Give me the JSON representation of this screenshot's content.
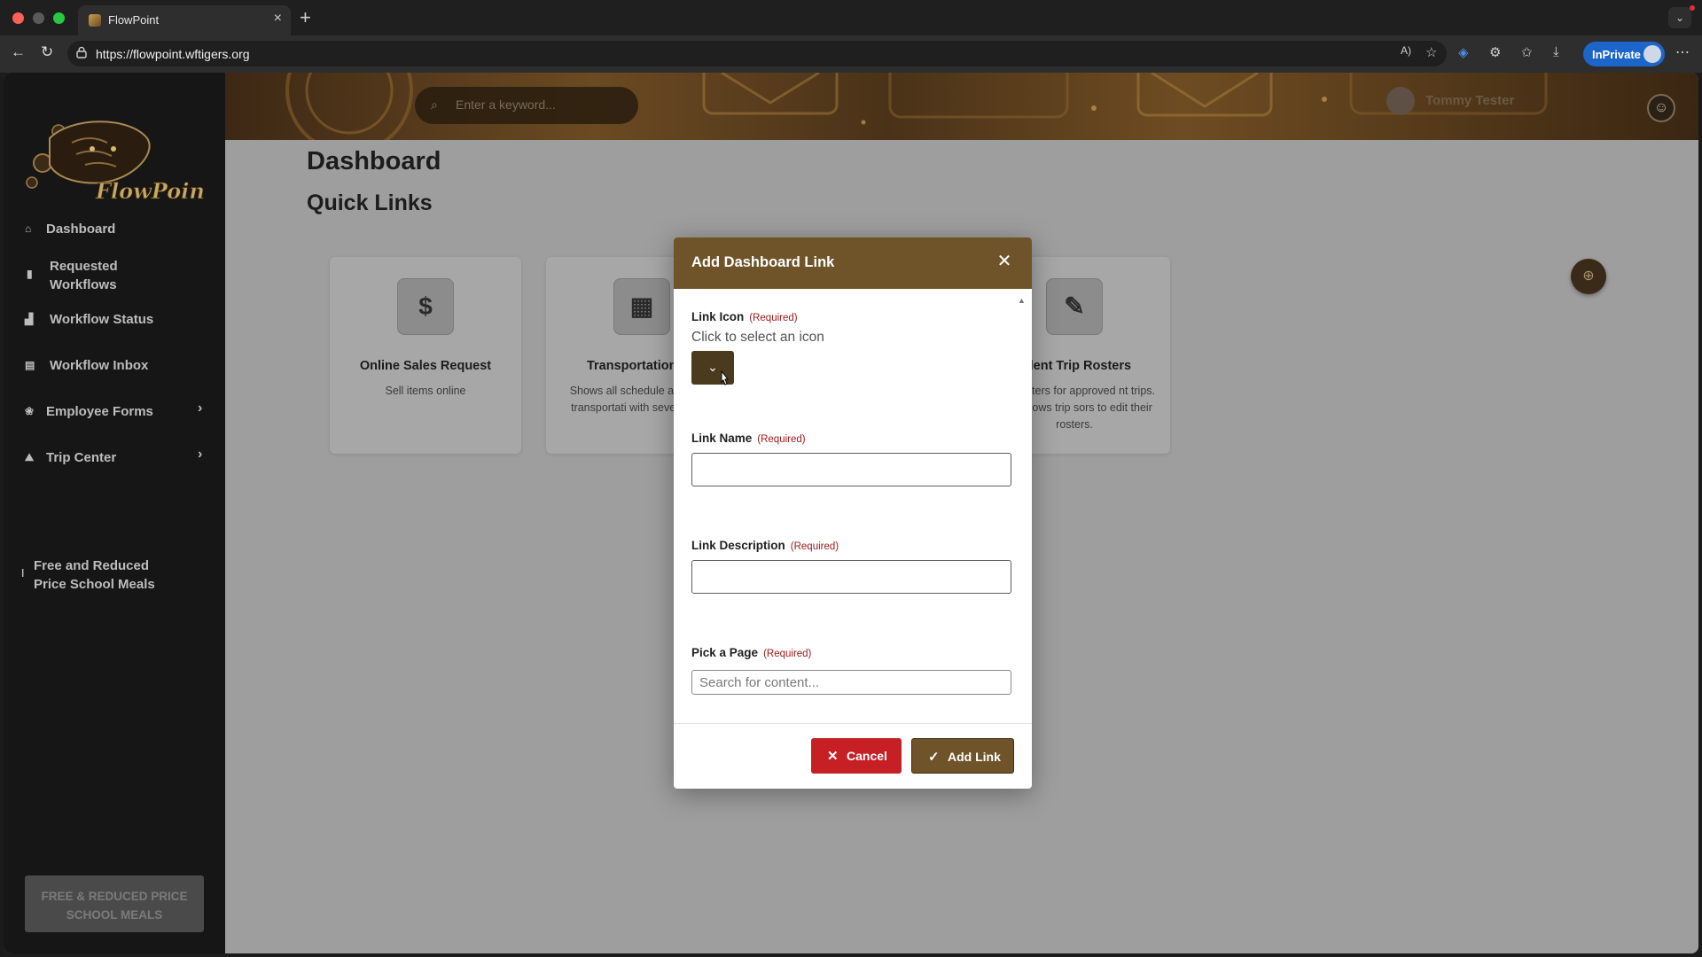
{
  "browser": {
    "tab_title": "FlowPoint",
    "url": "https://flowpoint.wftigers.org",
    "inprivate_label": "InPrivate"
  },
  "sidebar": {
    "logo_text": "FlowPoint",
    "items": [
      {
        "label": "Dashboard",
        "icon": "home-icon"
      },
      {
        "label": "Requested\nWorkflows",
        "icon": "document-icon"
      },
      {
        "label": "Workflow Status",
        "icon": "chart-icon"
      },
      {
        "label": "Workflow Inbox",
        "icon": "inbox-icon"
      },
      {
        "label": "Employee Forms",
        "icon": "paw-icon"
      },
      {
        "label": "Trip Center",
        "icon": "hiker-icon"
      },
      {
        "label": "Free and Reduced\nPrice School Meals",
        "icon": "utensil-icon"
      }
    ],
    "footer_button": "FREE & REDUCED PRICE SCHOOL MEALS"
  },
  "header": {
    "search_placeholder": "Enter a keyword...",
    "user_name": "Tommy Tester"
  },
  "main": {
    "title": "Dashboard",
    "subtitle": "Quick Links",
    "cards": [
      {
        "title": "Online Sales Request",
        "description": "Sell items online",
        "icon": "dollar-icon",
        "glyph": "$"
      },
      {
        "title": "Transportation Ca",
        "description": "Shows all schedule approved transportati with several deta",
        "icon": "calendar-icon",
        "glyph": "▦"
      },
      {
        "title": "udent Trip Rosters",
        "description": "s all rosters for approved nt trips. Also allows trip sors to edit their rosters.",
        "icon": "clipboard-icon",
        "glyph": "✎"
      }
    ]
  },
  "modal": {
    "title": "Add Dashboard Link",
    "required_tag": "(Required)",
    "icon_label": "Link Icon",
    "icon_hint": "Click to select an icon",
    "name_label": "Link Name",
    "name_value": "",
    "description_label": "Link Description",
    "description_value": "",
    "page_label": "Pick a Page",
    "page_placeholder": "Search for content...",
    "cancel_label": "Cancel",
    "add_label": "Add Link"
  },
  "colors": {
    "accent": "#6e5428",
    "danger": "#c62024",
    "sidebar": "#161616",
    "overlay_page": "#9e9e9e"
  }
}
